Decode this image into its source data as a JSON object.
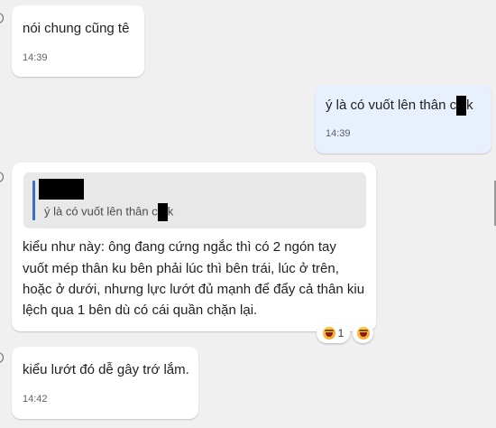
{
  "messages": [
    {
      "text": "nói chung cũng tê",
      "time": "14:39"
    },
    {
      "text_before": "ý là có vuốt lên thân c",
      "text_after": "k",
      "time": "14:39"
    },
    {
      "quote": {
        "text_before": "ý là có vuốt lên thân c",
        "text_after": "k"
      },
      "lines": [
        "kiểu như này: ông đang cứng ngắc thì có 2 ngón tay",
        "vuốt mép thân ku bên phải lúc thì bên trái, lúc ở trên,",
        "hoặc ở dưới, nhưng lực lướt đủ mạnh để đẩy cả thân kiu",
        "lệch qua 1 bên dù có cái quần chặn lại."
      ],
      "reactions": [
        {
          "emoji": "laughing-face-icon",
          "count": "1"
        },
        {
          "emoji": "laughing-face-icon",
          "count": ""
        }
      ]
    },
    {
      "text": "kiểu lướt đó dễ gây trớ lắm.",
      "time": "14:42"
    }
  ],
  "colors": {
    "background": "#f0f0f0",
    "incoming_bubble": "#ffffff",
    "outgoing_bubble": "#e8effd",
    "quote_bar": "#3b6cc7"
  }
}
